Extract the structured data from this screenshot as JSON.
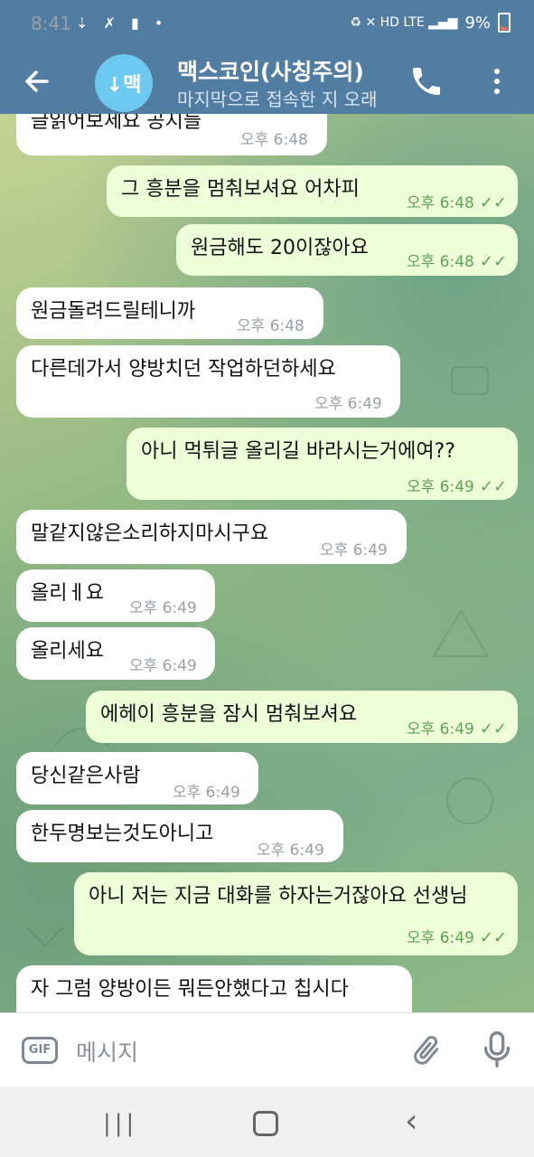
{
  "status_bar": {
    "time": "8:41",
    "left_icons": "⇣ ✗ ▮ •",
    "right_icons": "♻ ✕ HD LTE ▂▄▆",
    "battery": "9%"
  },
  "header": {
    "back_icon": "arrow-left",
    "avatar_text": "↓맥",
    "title": "맥스코인(사칭주의)",
    "subtitle": "마지막으로 접속한 지 오래",
    "call_icon": "phone",
    "more_icon": "three-dots"
  },
  "messages": [
    {
      "dir": "in",
      "text": "글읽어보세요 공지들",
      "time": "오후 6:48"
    },
    {
      "dir": "out",
      "text": "그 흥분을 멈춰보셔요 어차피",
      "time": "오후 6:48"
    },
    {
      "dir": "out",
      "text": "원금해도 20이잖아요",
      "time": "오후 6:48"
    },
    {
      "dir": "in",
      "text": "원금돌려드릴테니까",
      "time": "오후 6:48"
    },
    {
      "dir": "in",
      "text": "다른데가서 양방치던 작업하던하세요",
      "time": "오후 6:49"
    },
    {
      "dir": "out",
      "text": "아니 먹튀글 올리길 바라시는거에여??",
      "time": "오후 6:49"
    },
    {
      "dir": "in",
      "text": "말같지않은소리하지마시구요",
      "time": "오후 6:49"
    },
    {
      "dir": "in",
      "text": "올리ㅔ요",
      "time": "오후 6:49"
    },
    {
      "dir": "in",
      "text": "올리세요",
      "time": "오후 6:49"
    },
    {
      "dir": "out",
      "text": "에헤이 흥분을 잠시 멈춰보셔요",
      "time": "오후 6:49"
    },
    {
      "dir": "in",
      "text": "당신같은사람",
      "time": "오후 6:49"
    },
    {
      "dir": "in",
      "text": "한두명보는것도아니고",
      "time": "오후 6:49"
    },
    {
      "dir": "out",
      "text": "아니 저는 지금 대화를 하자는거잖아요 선생님",
      "time": "오후 6:49"
    },
    {
      "dir": "in",
      "text": "자 그럼 양방이든 뭐든안했다고 칩시다",
      "time": ""
    }
  ],
  "read_ticks": "✓✓",
  "input": {
    "gif_label": "GIF",
    "placeholder": "메시지",
    "attach_icon": "paperclip",
    "mic_icon": "microphone"
  },
  "navbar": {
    "recents_icon": "|||",
    "home_icon": "rounded-square",
    "back_icon": "‹"
  },
  "colors": {
    "header": "#527da3",
    "incoming_bubble": "#ffffff",
    "outgoing_bubble": "#eefed9",
    "read_check": "#5da352",
    "avatar": "#6ec9f1"
  }
}
